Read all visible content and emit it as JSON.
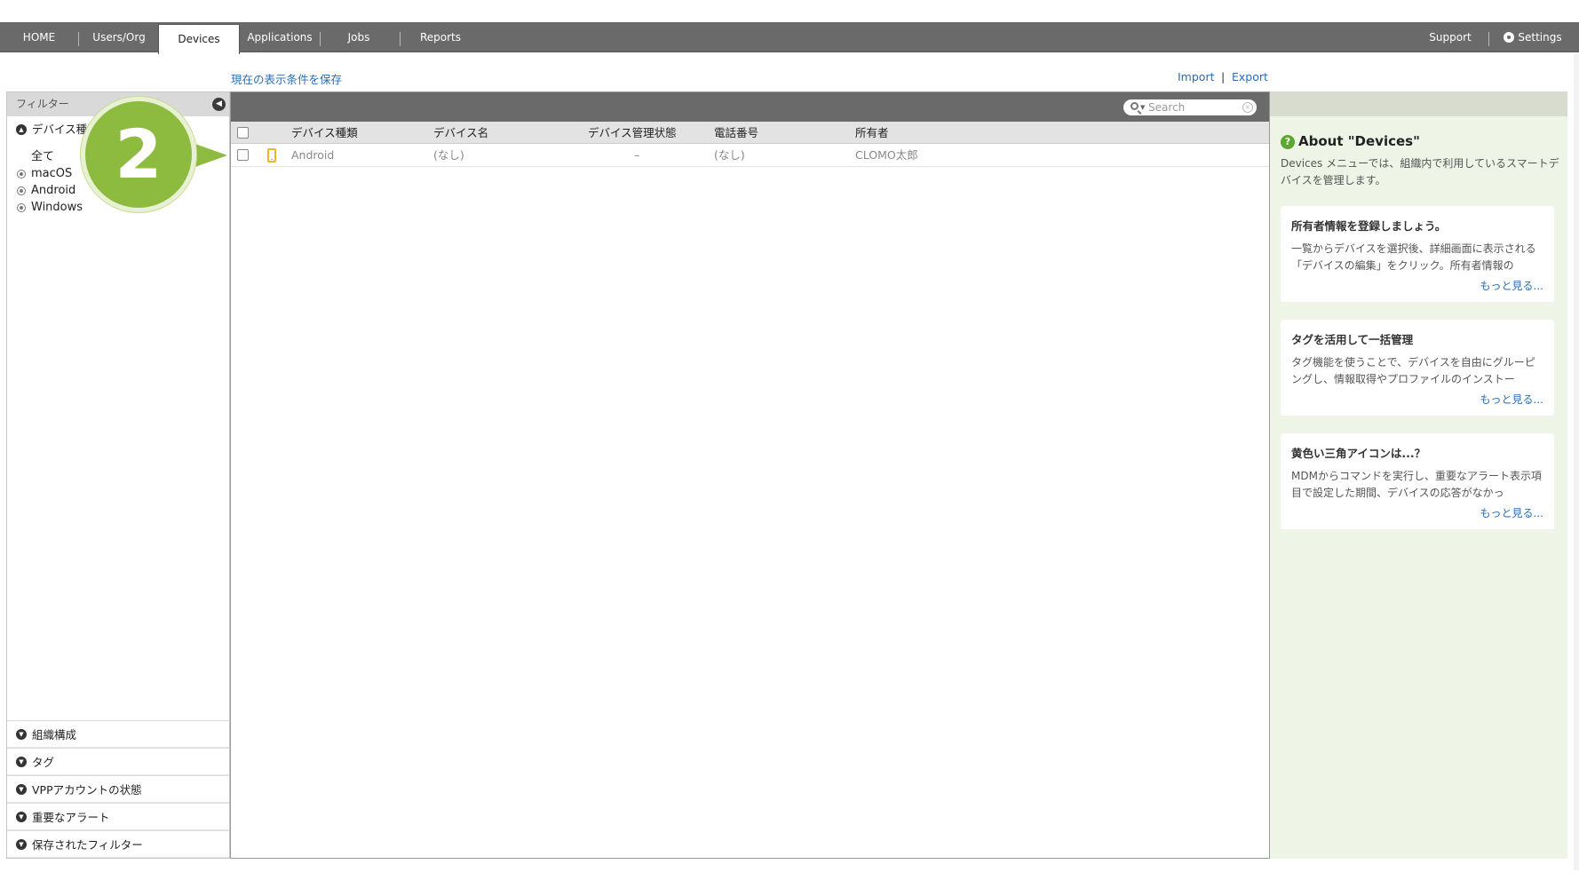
{
  "nav": {
    "tabs": [
      {
        "label": "HOME"
      },
      {
        "label": "Users/Org"
      },
      {
        "label": "Devices"
      },
      {
        "label": "Applications"
      },
      {
        "label": "Jobs"
      },
      {
        "label": "Reports"
      }
    ],
    "active_tab": "Devices",
    "support_label": "Support",
    "settings_label": "Settings"
  },
  "links": {
    "save_conditions": "現在の表示条件を保存",
    "import": "Import",
    "separator": "|",
    "export": "Export"
  },
  "sidebar": {
    "header": "フィルター",
    "device_type_section": "デバイス種類",
    "device_types": [
      {
        "label": "全て",
        "selected": true
      },
      {
        "label": "macOS"
      },
      {
        "label": "Android"
      },
      {
        "label": "Windows"
      }
    ],
    "sections": [
      {
        "label": "組織構成"
      },
      {
        "label": "タグ"
      },
      {
        "label": "VPPアカウントの状態"
      },
      {
        "label": "重要なアラート"
      },
      {
        "label": "保存されたフィルター"
      }
    ]
  },
  "table": {
    "search_placeholder": "Search",
    "columns": [
      "デバイス種類",
      "デバイス名",
      "デバイス管理状態",
      "電話番号",
      "所有者"
    ],
    "rows": [
      {
        "type": "Android",
        "name": "(なし)",
        "status": "–",
        "phone": "(なし)",
        "owner": "CLOMO太郎"
      }
    ]
  },
  "info": {
    "title": "About \"Devices\"",
    "description": "Devices メニューでは、組織内で利用しているスマートデバイスを管理します。",
    "cards": [
      {
        "title": "所有者情報を登録しましょう。",
        "body": "一覧からデバイスを選択後、詳細画面に表示される「デバイスの編集」をクリック。所有者情報の",
        "more": "もっと見る..."
      },
      {
        "title": "タグを活用して一括管理",
        "body": "タグ機能を使うことで、デバイスを自由にグルーピングし、情報取得やプロファイルのインストー",
        "more": "もっと見る..."
      },
      {
        "title": "黄色い三角アイコンは...？",
        "body": "MDMからコマンドを実行し、重要なアラート表示項目で設定した期間、デバイスの応答がなかっ",
        "more": "もっと見る..."
      }
    ]
  },
  "step_badge": "2",
  "colors": {
    "nav_bg": "#6a6a6a",
    "link": "#2a6db5",
    "badge": "#8dbb3f",
    "info_bg": "#eef5e6",
    "android_icon": "#f0b429"
  }
}
